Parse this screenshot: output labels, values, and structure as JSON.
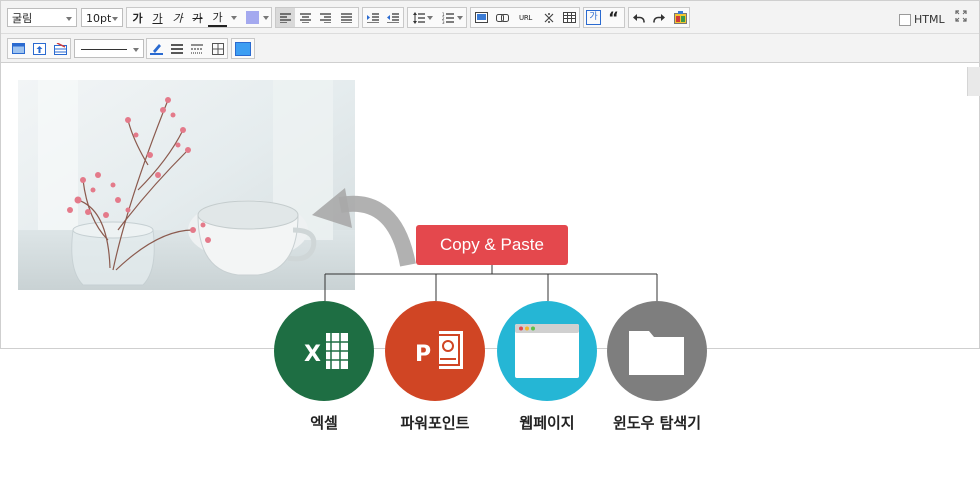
{
  "toolbar": {
    "font_family": "굴림",
    "font_size": "10pt",
    "bold_glyph": "가",
    "underline_glyph": "가",
    "italic_glyph": "가",
    "strike_glyph": "가",
    "color_glyph": "가",
    "url_label": "URL",
    "quote_glyph": "“",
    "html_label": "HTML",
    "icons": [
      "bold-icon",
      "underline-icon",
      "italic-icon",
      "strike-icon",
      "font-color-icon",
      "bg-color-icon",
      "align-left-icon",
      "align-center-icon",
      "align-right-icon",
      "align-justify-icon",
      "indent-icon",
      "outdent-icon",
      "line-height-icon",
      "list-icon",
      "image-icon",
      "link-icon",
      "url-icon",
      "special-char-icon",
      "table-icon",
      "spellcheck-icon",
      "quote-icon",
      "undo-icon",
      "redo-icon",
      "emoticon-icon",
      "fullscreen-icon"
    ]
  },
  "toolbar2": {
    "line_style": "",
    "icons": [
      "insert-box-icon",
      "upload-icon",
      "delete-row-icon",
      "line-style-icon",
      "pen-icon",
      "line-solid-icon",
      "line-dashed-icon",
      "grid-icon",
      "fill-color-icon"
    ]
  },
  "illustration": {
    "cta": "Copy & Paste",
    "targets": [
      {
        "label": "엑셀",
        "color": "#1e6e43",
        "icon": "excel-icon"
      },
      {
        "label": "파워포인트",
        "color": "#d04524",
        "icon": "powerpoint-icon"
      },
      {
        "label": "웹페이지",
        "color": "#25b6d5",
        "icon": "webpage-icon"
      },
      {
        "label": "윈도우 탐색기",
        "color": "#7e7e7e",
        "icon": "folder-icon"
      }
    ]
  },
  "colors": {
    "accent": "#e4484d"
  }
}
